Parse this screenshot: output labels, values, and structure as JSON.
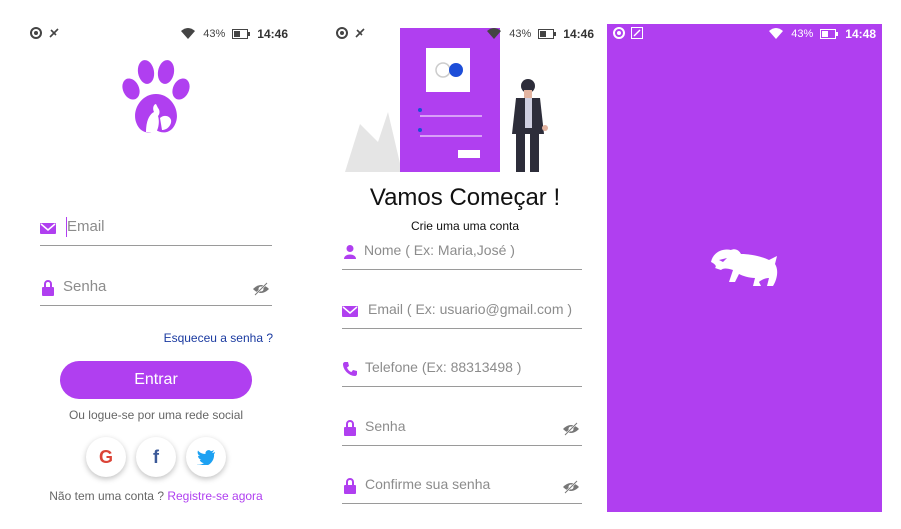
{
  "statusbar": {
    "battery": "43%",
    "time_login": "14:46",
    "time_signup": "14:46",
    "time_splash": "14:48"
  },
  "login": {
    "email_placeholder": "Email",
    "password_placeholder": "Senha",
    "forgot_password": "Esqueceu a senha ?",
    "enter_button": "Entrar",
    "social_prompt": "Ou logue-se por uma rede social",
    "google_label": "G",
    "facebook_label": "f",
    "no_account": "Não tem uma conta ?",
    "register_link": "Registre-se agora"
  },
  "signup": {
    "title": "Vamos Começar !",
    "subtitle": "Crie uma uma conta",
    "fields": {
      "name": "Nome ( Ex: Maria,José )",
      "email": "Email ( Ex: usuario@gmail.com )",
      "phone": "Telefone (Ex: 88313498 )",
      "password": "Senha",
      "confirm": "Confirme sua senha"
    }
  },
  "colors": {
    "accent": "#b03ff0",
    "link": "#1a3aa0",
    "google": "#db4437",
    "facebook": "#3b5998",
    "twitter": "#1da1f2"
  }
}
